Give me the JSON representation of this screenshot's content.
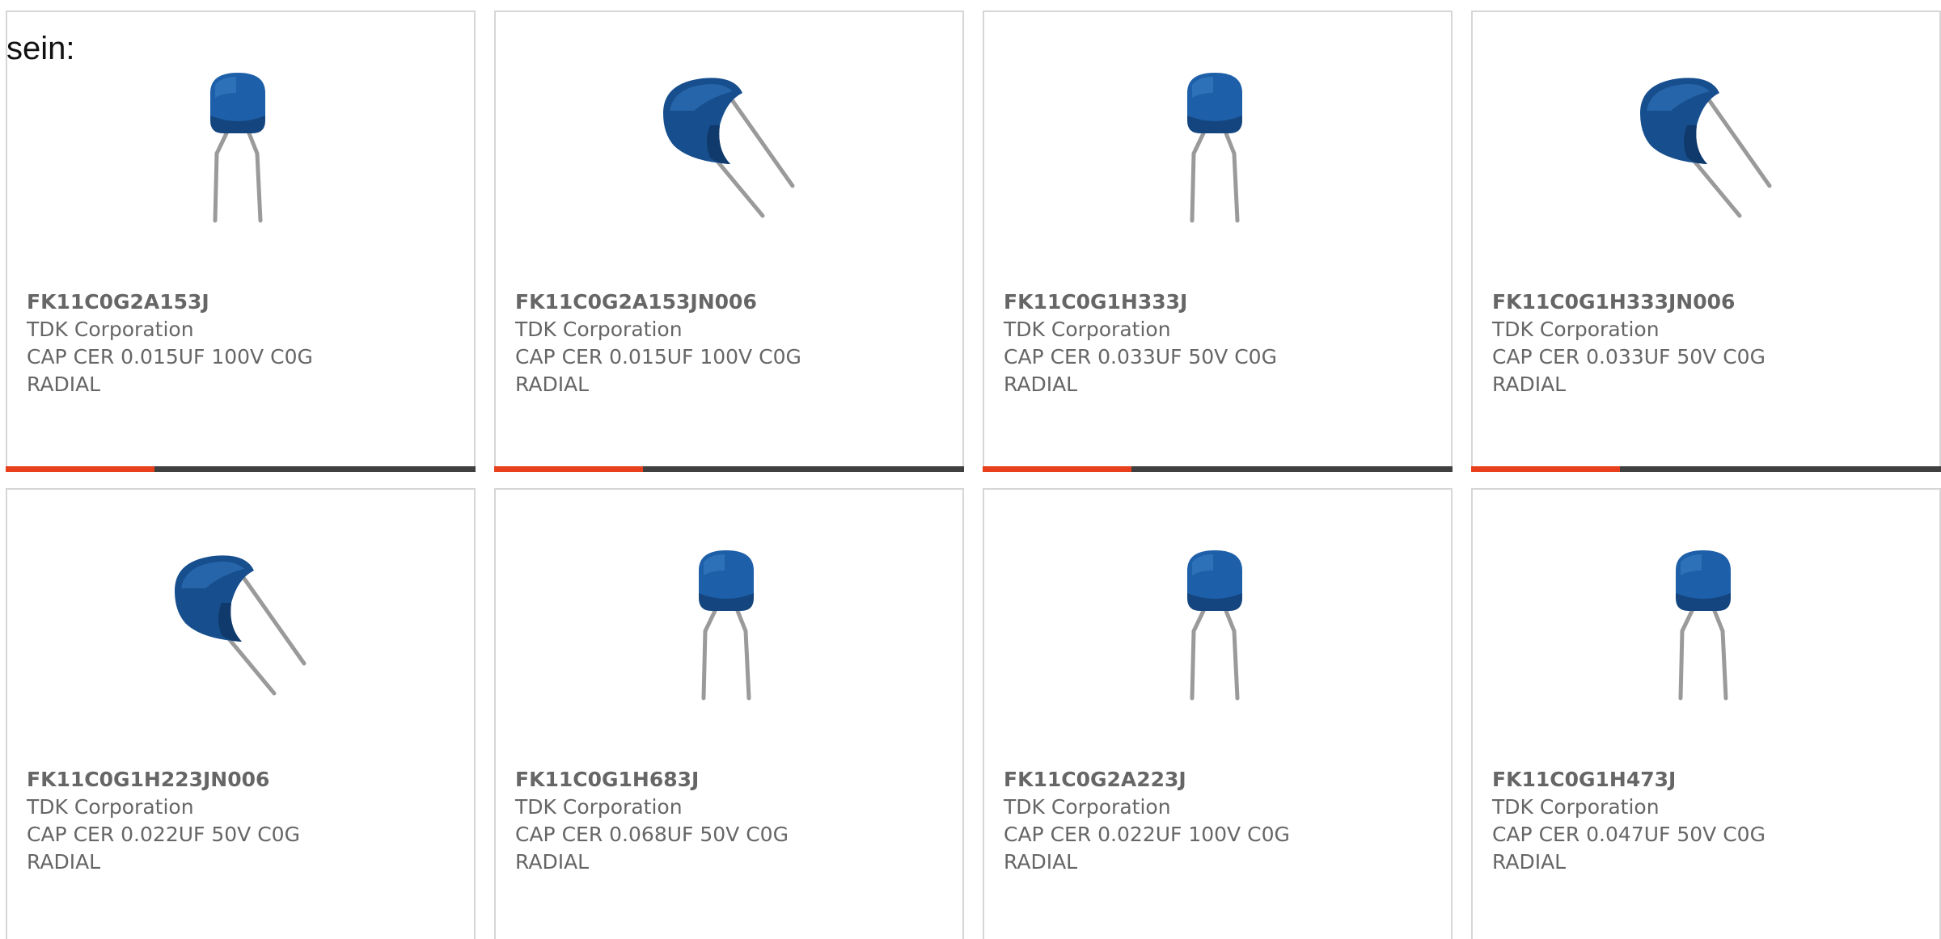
{
  "intro_text": "sein:",
  "colors": {
    "accent": "#e8401c",
    "bar": "#404040",
    "capacitor_body": "#1d5fa8",
    "lead": "#9a9a9a"
  },
  "cards": [
    {
      "part_number": "FK11C0G2A153J",
      "manufacturer": "TDK Corporation",
      "description_line1": "CAP CER 0.015UF 100V C0G",
      "description_line2": "RADIAL",
      "image_icon": "upright-radial-capacitor-image"
    },
    {
      "part_number": "FK11C0G2A153JN006",
      "manufacturer": "TDK Corporation",
      "description_line1": "CAP CER 0.015UF 100V C0G",
      "description_line2": "RADIAL",
      "image_icon": "bent-radial-capacitor-image"
    },
    {
      "part_number": "FK11C0G1H333J",
      "manufacturer": "TDK Corporation",
      "description_line1": "CAP CER 0.033UF 50V C0G",
      "description_line2": "RADIAL",
      "image_icon": "upright-radial-capacitor-image"
    },
    {
      "part_number": "FK11C0G1H333JN006",
      "manufacturer": "TDK Corporation",
      "description_line1": "CAP CER 0.033UF 50V C0G",
      "description_line2": "RADIAL",
      "image_icon": "bent-radial-capacitor-image"
    },
    {
      "part_number": "FK11C0G1H223JN006",
      "manufacturer": "TDK Corporation",
      "description_line1": "CAP CER 0.022UF 50V C0G",
      "description_line2": "RADIAL",
      "image_icon": "bent-radial-capacitor-image"
    },
    {
      "part_number": "FK11C0G1H683J",
      "manufacturer": "TDK Corporation",
      "description_line1": "CAP CER 0.068UF 50V C0G",
      "description_line2": "RADIAL",
      "image_icon": "upright-radial-capacitor-image"
    },
    {
      "part_number": "FK11C0G2A223J",
      "manufacturer": "TDK Corporation",
      "description_line1": "CAP CER 0.022UF 100V C0G",
      "description_line2": "RADIAL",
      "image_icon": "upright-radial-capacitor-image"
    },
    {
      "part_number": "FK11C0G1H473J",
      "manufacturer": "TDK Corporation",
      "description_line1": "CAP CER 0.047UF 50V C0G",
      "description_line2": "RADIAL",
      "image_icon": "upright-radial-capacitor-image"
    }
  ]
}
